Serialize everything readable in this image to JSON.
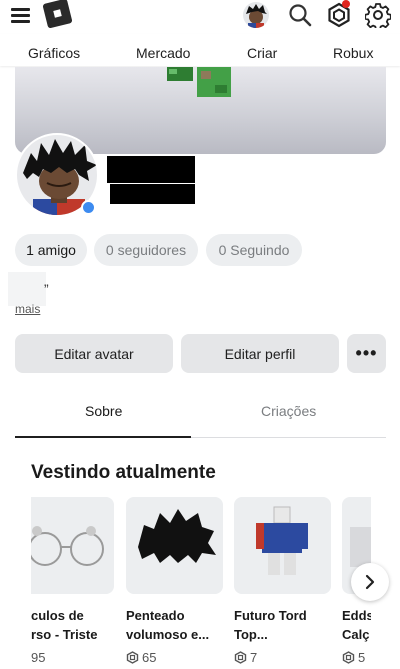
{
  "nav": [
    "Gráficos",
    "Mercado",
    "Criar",
    "Robux"
  ],
  "stats": {
    "friends": "1 amigo",
    "followers": "0 seguidores",
    "following": "0 Seguindo"
  },
  "about": {
    "quote": "”",
    "more_link": "mais"
  },
  "buttons": {
    "edit_avatar": "Editar avatar",
    "edit_profile": "Editar perfil",
    "more": "•••"
  },
  "tabs": {
    "about": "Sobre",
    "creations": "Criações",
    "active": "about"
  },
  "section": {
    "title": "Vestindo atualmente",
    "items": [
      {
        "name1": "culos de",
        "name2": "rso - Triste",
        "price": "95"
      },
      {
        "name1": "Penteado",
        "name2": "volumoso e...",
        "price": "65"
      },
      {
        "name1": "Futuro Tord",
        "name2": "Top...",
        "price": "7"
      },
      {
        "name1": "Edds",
        "name2": "Calç",
        "price": "5"
      }
    ]
  },
  "colors": {
    "accent_blue": "#3d8bf0",
    "notification_red": "#e0261f",
    "pill_bg": "#eceef0"
  }
}
